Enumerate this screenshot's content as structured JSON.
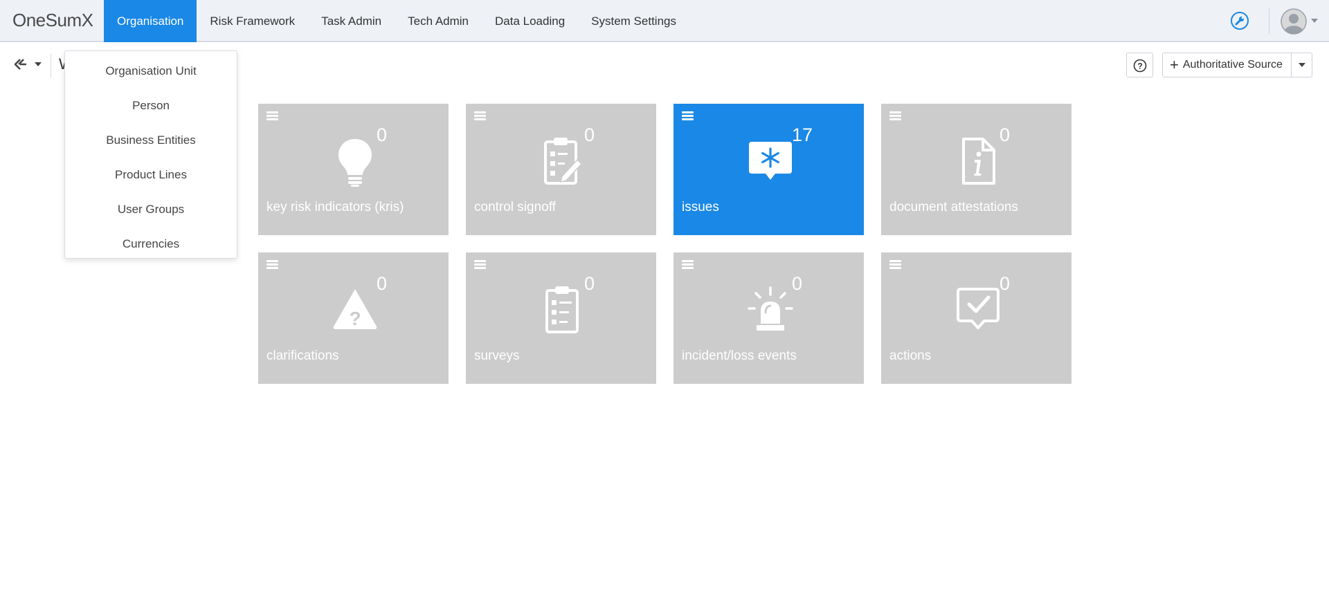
{
  "app": {
    "logo": "OneSumX"
  },
  "nav": {
    "items": [
      {
        "label": "Organisation",
        "active": true
      },
      {
        "label": "Risk Framework",
        "active": false
      },
      {
        "label": "Task Admin",
        "active": false
      },
      {
        "label": "Tech Admin",
        "active": false
      },
      {
        "label": "Data Loading",
        "active": false
      },
      {
        "label": "System Settings",
        "active": false
      }
    ]
  },
  "header": {
    "icons": [
      "wrench-icon",
      "avatar-icon",
      "chevron-down-icon"
    ]
  },
  "subbar": {
    "title_partial": "W",
    "help_icon": "question-circle-icon",
    "auth_button_label": "Authoritative Source"
  },
  "dropdown": {
    "items": [
      "Organisation Unit",
      "Person",
      "Business Entities",
      "Product Lines",
      "User Groups",
      "Currencies"
    ]
  },
  "tiles": [
    {
      "label": "key risk indicators (kris)",
      "count": "0",
      "icon": "lightbulb-icon",
      "active": false
    },
    {
      "label": "control signoff",
      "count": "0",
      "icon": "clipboard-edit-icon",
      "active": false
    },
    {
      "label": "issues",
      "count": "17",
      "icon": "chat-asterisk-icon",
      "active": true
    },
    {
      "label": "document attestations",
      "count": "0",
      "icon": "document-info-icon",
      "active": false
    },
    {
      "label": "clarifications",
      "count": "0",
      "icon": "warning-question-icon",
      "active": false
    },
    {
      "label": "surveys",
      "count": "0",
      "icon": "clipboard-list-icon",
      "active": false
    },
    {
      "label": "incident/loss events",
      "count": "0",
      "icon": "alarm-light-icon",
      "active": false
    },
    {
      "label": "actions",
      "count": "0",
      "icon": "chat-check-icon",
      "active": false
    }
  ],
  "colors": {
    "accent": "#1a88e6",
    "tile_bg": "#cccccc",
    "nav_bg": "#eef1f6"
  }
}
